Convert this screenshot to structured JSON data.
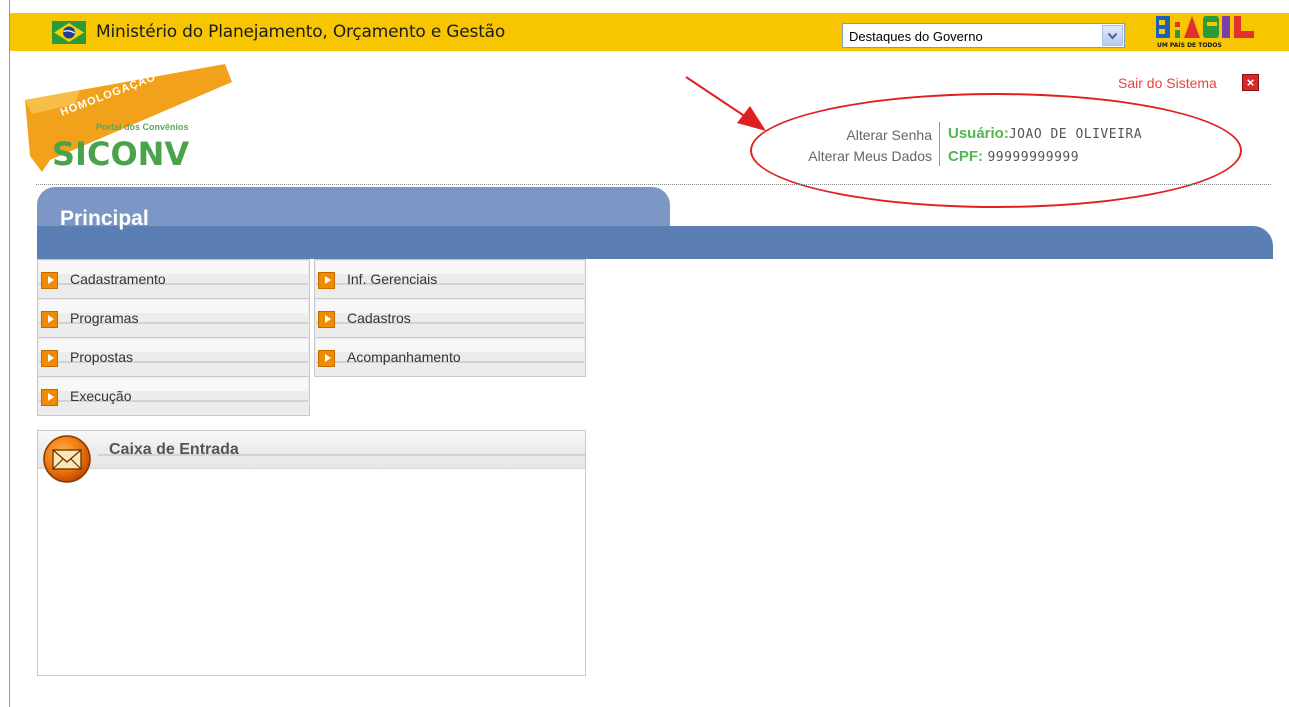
{
  "gov_bar": {
    "title": "Ministério do Planejamento, Orçamento e Gestão",
    "select_value": "Destaques do Governo",
    "brasil_logo_text": "BRASIL",
    "brasil_logo_slogan": "UM PAÍS DE TODOS",
    "colors": {
      "bar": "#f7c600"
    }
  },
  "logo": {
    "banner": "HOMOLOGAÇÃO",
    "subtitle": "Portal dos Convênios",
    "name": "SICONV"
  },
  "header": {
    "logout_label": "Sair do Sistema",
    "logout_icon": "close-icon",
    "links": [
      "Alterar Senha",
      "Alterar Meus Dados"
    ],
    "user_label": "Usuário:",
    "user_value": "JOAO DE OLIVEIRA",
    "cpf_label": "CPF:",
    "cpf_value": "99999999999"
  },
  "main_tab": {
    "title": "Principal"
  },
  "menu": {
    "col1": [
      {
        "label": "Cadastramento",
        "icon": "arrow-right-icon"
      },
      {
        "label": "Programas",
        "icon": "arrow-right-icon"
      },
      {
        "label": "Propostas",
        "icon": "arrow-right-icon"
      },
      {
        "label": "Execução",
        "icon": "arrow-right-icon"
      }
    ],
    "col2": [
      {
        "label": "Inf. Gerenciais",
        "icon": "arrow-right-icon"
      },
      {
        "label": "Cadastros",
        "icon": "arrow-right-icon"
      },
      {
        "label": "Acompanhamento",
        "icon": "arrow-right-icon"
      }
    ]
  },
  "inbox": {
    "title": "Caixa de Entrada",
    "icon": "envelope-icon"
  },
  "annotation": {
    "color": "#e02020"
  }
}
